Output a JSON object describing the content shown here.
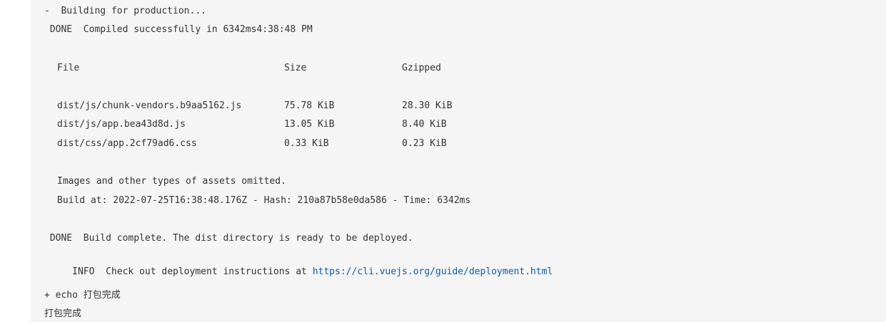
{
  "console": {
    "building": "-  Building for production...",
    "compiled": " DONE  Compiled successfully in 6342ms4:38:48 PM",
    "table": {
      "headers": {
        "file": "File",
        "size": "Size",
        "gzipped": "Gzipped"
      },
      "rows": [
        {
          "file": "dist/js/chunk-vendors.b9aa5162.js",
          "size": "75.78 KiB",
          "gzipped": "28.30 KiB"
        },
        {
          "file": "dist/js/app.bea43d8d.js",
          "size": "13.05 KiB",
          "gzipped": "8.40 KiB"
        },
        {
          "file": "dist/css/app.2cf79ad6.css",
          "size": "0.33 KiB",
          "gzipped": "0.23 KiB"
        }
      ]
    },
    "assets_omitted": "Images and other types of assets omitted.",
    "build_info": "Build at: 2022-07-25T16:38:48.176Z - Hash: 210a87b58e0da586 - Time: 6342ms",
    "done_build": " DONE  Build complete. The dist directory is ready to be deployed.",
    "info_prefix": " INFO  Check out deployment instructions at ",
    "info_link": "https://cli.vuejs.org/guide/deployment.html",
    "echo_cmd": "+ echo 打包完成",
    "echo_out": "打包完成"
  },
  "colors": {
    "background": "#f5f5f5",
    "text": "#333333",
    "link": "#0b5ea8"
  }
}
